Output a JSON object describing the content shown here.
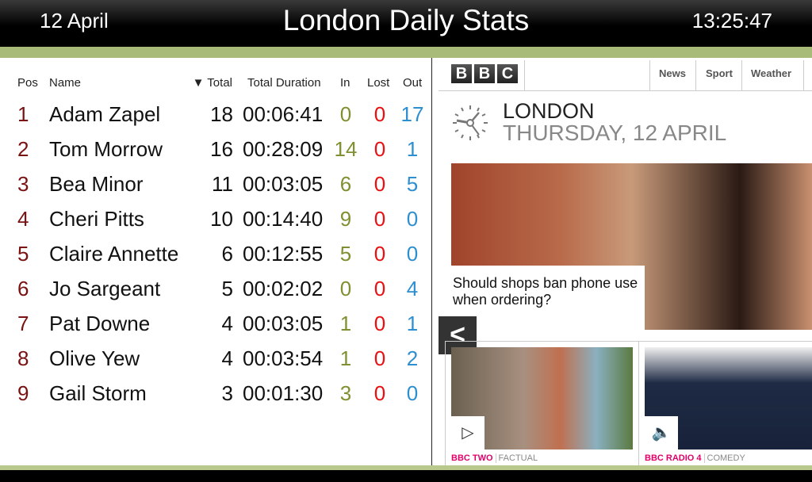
{
  "header": {
    "date": "12 April",
    "title": "London Daily Stats",
    "time": "13:25:47"
  },
  "table": {
    "columns": {
      "pos": "Pos",
      "name": "Name",
      "total": "▼ Total",
      "duration": "Total Duration",
      "in": "In",
      "lost": "Lost",
      "out": "Out"
    },
    "rows": [
      {
        "pos": "1",
        "name": "Adam Zapel",
        "total": "18",
        "duration": "00:06:41",
        "in": "0",
        "lost": "0",
        "out": "17"
      },
      {
        "pos": "2",
        "name": "Tom Morrow",
        "total": "16",
        "duration": "00:28:09",
        "in": "14",
        "lost": "0",
        "out": "1"
      },
      {
        "pos": "3",
        "name": "Bea Minor",
        "total": "11",
        "duration": "00:03:05",
        "in": "6",
        "lost": "0",
        "out": "5"
      },
      {
        "pos": "4",
        "name": "Cheri Pitts",
        "total": "10",
        "duration": "00:14:40",
        "in": "9",
        "lost": "0",
        "out": "0"
      },
      {
        "pos": "5",
        "name": "Claire Annette",
        "total": "6",
        "duration": "00:12:55",
        "in": "5",
        "lost": "0",
        "out": "0"
      },
      {
        "pos": "6",
        "name": "Jo Sargeant",
        "total": "5",
        "duration": "00:02:02",
        "in": "0",
        "lost": "0",
        "out": "4"
      },
      {
        "pos": "7",
        "name": "Pat Downe",
        "total": "4",
        "duration": "00:03:05",
        "in": "1",
        "lost": "0",
        "out": "1"
      },
      {
        "pos": "8",
        "name": "Olive Yew",
        "total": "4",
        "duration": "00:03:54",
        "in": "1",
        "lost": "0",
        "out": "2"
      },
      {
        "pos": "9",
        "name": "Gail Storm",
        "total": "3",
        "duration": "00:01:30",
        "in": "3",
        "lost": "0",
        "out": "0"
      }
    ]
  },
  "bbc": {
    "logo": [
      "B",
      "B",
      "C"
    ],
    "nav": [
      "News",
      "Sport",
      "Weather"
    ],
    "city": "LONDON",
    "day": "THURSDAY, 12 APRIL",
    "hero_caption": "Should shops ban phone use when ordering?",
    "back": "<",
    "tiles": [
      {
        "channel": "BBC TWO",
        "genre": "FACTUAL",
        "icon": "iplayer-icon"
      },
      {
        "channel": "BBC RADIO 4",
        "genre": "COMEDY",
        "icon": "speaker-icon"
      }
    ]
  }
}
